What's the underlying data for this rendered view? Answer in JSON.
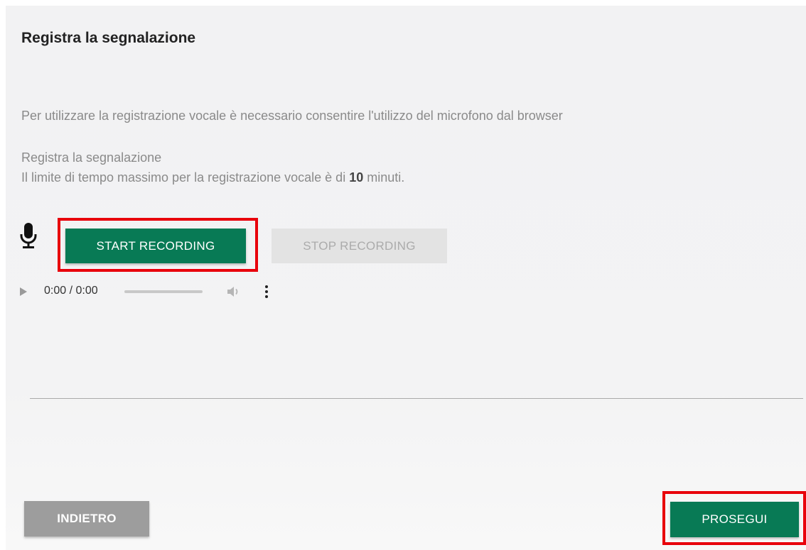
{
  "page": {
    "title": "Registra la segnalazione",
    "info": "Per utilizzare la registrazione vocale è necessario consentire l'utilizzo del microfono dal browser",
    "subtitle": "Registra la segnalazione",
    "limit": {
      "prefix": "Il limite di tempo massimo per la registrazione vocale è di ",
      "minutes": "10",
      "suffix": " minuti."
    }
  },
  "recorder": {
    "mic_icon": "microphone-icon",
    "start_label": "START RECORDING",
    "stop_label": "STOP RECORDING",
    "stop_enabled": false
  },
  "audio_player": {
    "play_icon": "play-icon",
    "time": "0:00 / 0:00",
    "progress": 0,
    "volume_icon": "volume-icon",
    "menu_icon": "more-vertical-icon"
  },
  "footer": {
    "back_label": "INDIETRO",
    "next_label": "PROSEGUI"
  },
  "colors": {
    "primary": "#087a55",
    "disabled_bg": "#e3e3e3",
    "secondary_bg": "#9d9d9d",
    "highlight": "#e8000b"
  }
}
